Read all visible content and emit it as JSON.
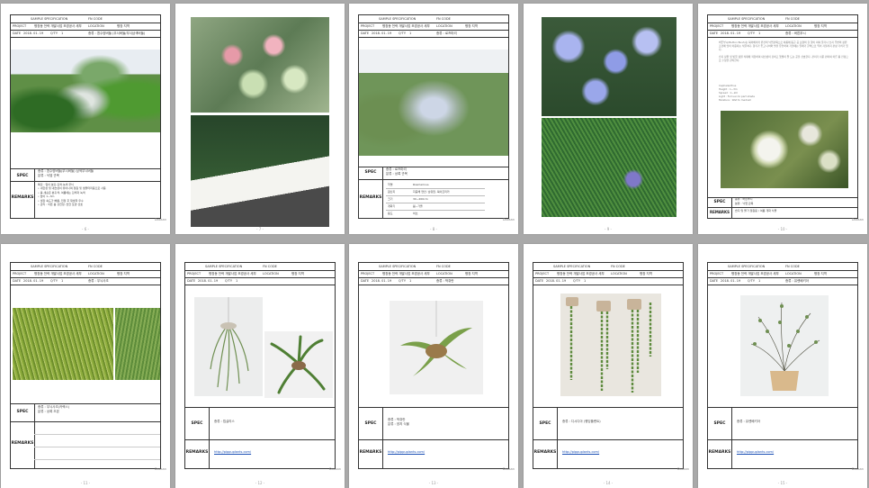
{
  "header": {
    "title_label": "SAMPLE SPECIFICATION",
    "code_label": "FN CODE",
    "project_label": "PROJECT",
    "project_value": "평창동 전략 개발사업 조경공사 세부",
    "location_label": "LOCATION",
    "location_value": "평창 지역",
    "date_label": "DATE",
    "date_value": "2018. 01. 19",
    "qty_label": "Q'TY",
    "qty_value": "1"
  },
  "labels": {
    "spec": "SPEC",
    "remarks": "REMARKS"
  },
  "brand": "Doosan",
  "pages": [
    {
      "pnum": "- 6 -",
      "plant": "종류 : 흰수양버들 (무늬버들/무늬삼색버들)",
      "spec_text": "종류 : 흰수양버들(무늬버들) 삼색무늬버들\n분류 : 낙엽 관목",
      "remarks_text": "특징 : 잎이 분홍·흰색·녹색 무늬\n• 내한성 및 내습성이 뛰어나며 정원 및 생울타리용으로 사용\n• 봄 새순은 분홍색, 여름에는 흰색과 녹색\n• 높이 1~3m\n• 생장 속도가 빠름, 전정 후 재생력 우수\n• 관리 : 이른 봄 강전정, 습한 토양 선호"
    },
    {
      "pnum": "- 7 -"
    },
    {
      "pnum": "- 8 -",
      "plant": "종류 : 로즈마리",
      "spec_text": "종류 : 로즈마리\n분류 : 상록 관목",
      "table": [
        {
          "k": "학명",
          "v": "Rosmarinus"
        },
        {
          "k": "원산지",
          "v": "지중해 연안, 남유럽, 북아프리카"
        },
        {
          "k": "크기",
          "v": "30~200cm"
        },
        {
          "k": "개화기",
          "v": "봄~가을"
        },
        {
          "k": "용도",
          "v": "허브"
        }
      ]
    },
    {
      "pnum": "- 9 -"
    },
    {
      "pnum": "- 10 -",
      "plant": "종류 : 버튼부시",
      "intro": "버튼부시(Button Bush)는 북아메리카 원산의 낙엽관목으로 여름에 둥근 공 모양의 흰 꽃이 피며 물가나 습지 주변의 정원 조경에 많이 이용되는 식물이다. 향기가 좋고 나비와 벌을 유인하며 가을에는 열매가 갈색으로 익어 겨울까지 관상 가치가 있다.\n\n습지 정원 및 빗물 정원 식재에 적합하며 내습성이 강하고 햇빛이 잘 드는 곳을 선호한다. 관리가 쉬운 편이며 이른 봄 전정으로 수형을 관리한다.",
      "facts": "Cephalanthus\nHeight : 1~3m\nSpread : 1~2m\nLight : Full sun to part shade\nMoisture : Wet to medium",
      "spec_text": "종류 : 버튼부시\n분류 : 낙엽 관목",
      "remarks_text": "습지 및 물가 정원용 / 여름 개화 식물"
    },
    {
      "pnum": "- 11 -",
      "plant": "종류 : 무늬사초",
      "spec_text": "종류 : 무늬사초(카렉스)\n분류 : 상록 초본",
      "remarks_text": ""
    },
    {
      "pnum": "- 12 -",
      "plant": "",
      "spec_text": "종류 : 립살리스",
      "link": "http://pippuplants.com/"
    },
    {
      "pnum": "- 13 -",
      "plant": "종류 : 박쥐란",
      "spec_text": "종류 : 박쥐란\n분류 : 양치 식물",
      "link": "http://pippuplants.com/"
    },
    {
      "pnum": "- 14 -",
      "plant": "",
      "spec_text": "종류 : 디시디아 (행잉플랜트)",
      "link": "http://pippuplants.com/"
    },
    {
      "pnum": "- 15 -",
      "plant": "종류 : 뮤렌베키아",
      "spec_text": "종류 : 뮤렌베키아",
      "link": "http://pippuplants.com/"
    }
  ]
}
